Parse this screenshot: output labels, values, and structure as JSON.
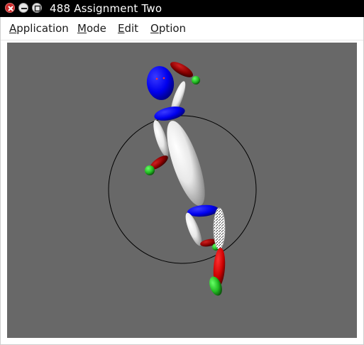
{
  "window": {
    "title": "488 Assignment Two",
    "controls": {
      "close": "close-icon",
      "minimize": "minimize-icon",
      "maximize": "maximize-icon"
    }
  },
  "menu": [
    {
      "label": "Application",
      "mnemonic": "A",
      "rest": "pplication"
    },
    {
      "label": "Mode",
      "mnemonic": "M",
      "rest": "ode"
    },
    {
      "label": "Edit",
      "mnemonic": "E",
      "rest": "dit"
    },
    {
      "label": "Option",
      "mnemonic": "O",
      "rest": "ption"
    }
  ],
  "colors": {
    "viewport_background": "#686868",
    "limb_white": "#f2f2f2",
    "joint_blue": "#0000ee",
    "limb_red": "#cc0000",
    "joint_green": "#22bb22",
    "trackball_circle": "#000000"
  }
}
